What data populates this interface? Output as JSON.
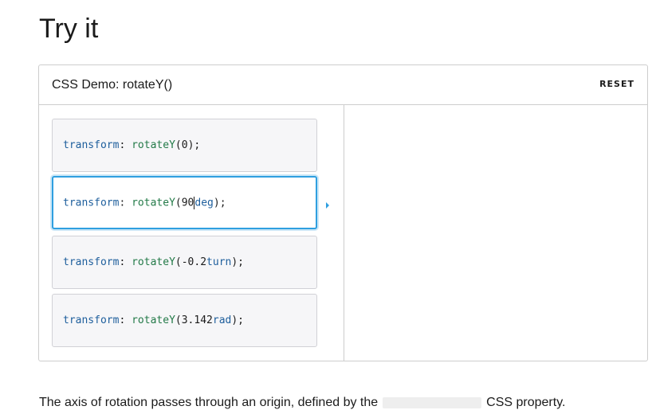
{
  "page": {
    "heading": "Try it"
  },
  "demo": {
    "title": "CSS Demo: rotateY()",
    "reset_label": "RESET",
    "choices": [
      {
        "property": "transform",
        "colon": ": ",
        "function": "rotateY",
        "open": "(",
        "value": "0",
        "unit": "",
        "close": ");"
      },
      {
        "property": "transform",
        "colon": ": ",
        "function": "rotateY",
        "open": "(",
        "value": "90",
        "unit": "deg",
        "close": ");"
      },
      {
        "property": "transform",
        "colon": ": ",
        "function": "rotateY",
        "open": "(",
        "value": "-0.2",
        "unit": "turn",
        "close": ");"
      },
      {
        "property": "transform",
        "colon": ": ",
        "function": "rotateY",
        "open": "(",
        "value": "3.142",
        "unit": "rad",
        "close": ");"
      }
    ],
    "selected_index": 1
  },
  "footer": {
    "text_before": "The axis of rotation passes through an origin, defined by the",
    "text_after": "CSS property."
  },
  "colors": {
    "accent": "#2f9fe0",
    "property": "#1d5e9c",
    "function": "#237a48"
  }
}
